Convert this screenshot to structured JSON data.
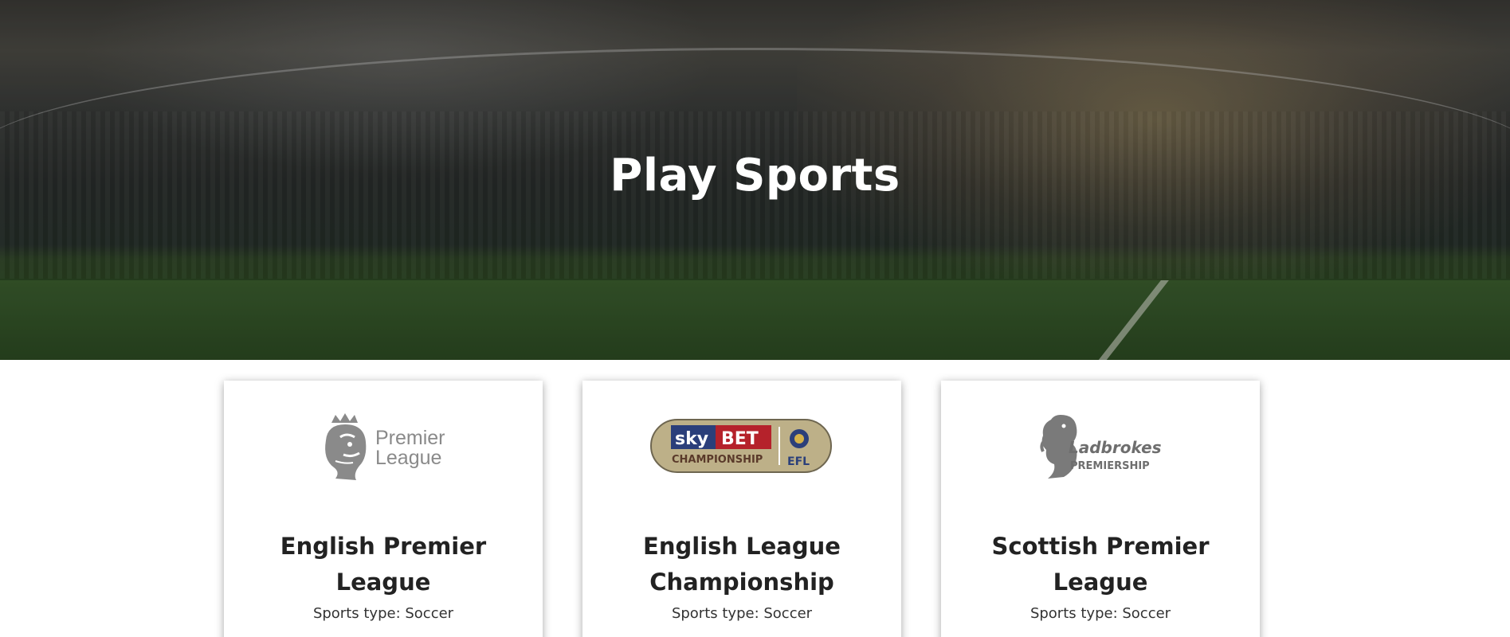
{
  "hero": {
    "title": "Play Sports"
  },
  "leagues": [
    {
      "name": "English Premier League",
      "sport_type": "Sports type: Soccer",
      "logo_text": [
        "Premier",
        "League"
      ]
    },
    {
      "name": "English League Championship",
      "sport_type": "Sports type: Soccer",
      "logo_text": [
        "sky",
        "BET",
        "CHAMPIONSHIP",
        "EFL"
      ]
    },
    {
      "name": "Scottish Premier League",
      "sport_type": "Sports type: Soccer",
      "logo_text": [
        "Ladbrokes",
        "PREMIERSHIP"
      ]
    }
  ],
  "colors": {
    "logo_grey": "#8a8a8a",
    "sky_blue": "#2b3f7a",
    "bet_red": "#b5222b",
    "champ_gold": "#b9ab7a"
  }
}
